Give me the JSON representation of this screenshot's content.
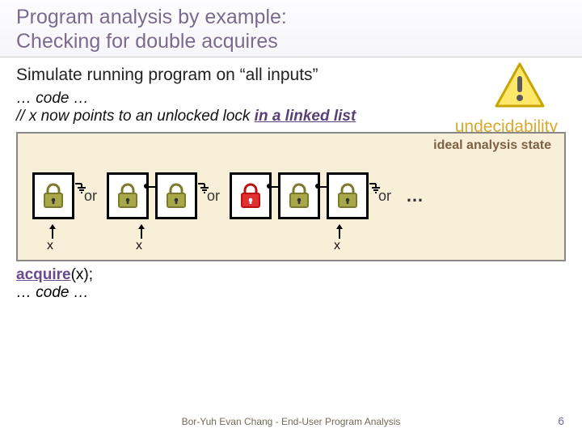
{
  "title_line1": "Program analysis by example:",
  "title_line2": "Checking for double acquires",
  "subtitle": "Simulate running program on “all inputs”",
  "undecidability": "undecidability",
  "code": {
    "line1": "… code …",
    "line2_prefix": "//  x now points to an unlocked lock ",
    "line2_em": "in a linked list"
  },
  "ideal_label": "ideal analysis state",
  "or": "or",
  "dots": "…",
  "x_label": "x",
  "after": {
    "acquire": "acquire",
    "acquire_args": "(x);",
    "line2": "… code …"
  },
  "footer": "Bor-Yuh Evan Chang - End-User Program Analysis",
  "page": "6"
}
